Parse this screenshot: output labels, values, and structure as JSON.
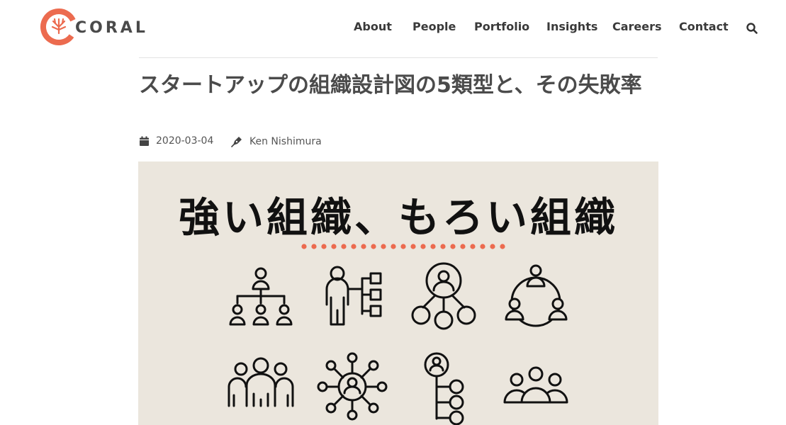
{
  "brand": {
    "name": "CORAL",
    "accent": "#ec6b4f"
  },
  "nav": {
    "items": [
      {
        "label": "About"
      },
      {
        "label": "People"
      },
      {
        "label": "Portfolio"
      },
      {
        "label": "Insights"
      },
      {
        "label": "Careers"
      },
      {
        "label": "Contact"
      }
    ],
    "search_icon": "search-icon"
  },
  "article": {
    "title": "スタートアップの組織設計図の5類型と、その失敗率",
    "date": "2020-03-04",
    "author": "Ken Nishimura",
    "date_icon": "calendar-icon",
    "author_icon": "pen-icon"
  },
  "hero": {
    "heading": "強い組織、もろい組織",
    "background": "#ebe6dd",
    "dot_color": "#ec6b4f",
    "icons": [
      "hierarchy-org-icon",
      "person-chart-icon",
      "hub-network-icon",
      "circular-team-icon",
      "crowd-group-icon",
      "star-network-icon",
      "person-tree-icon",
      "three-people-icon"
    ]
  }
}
